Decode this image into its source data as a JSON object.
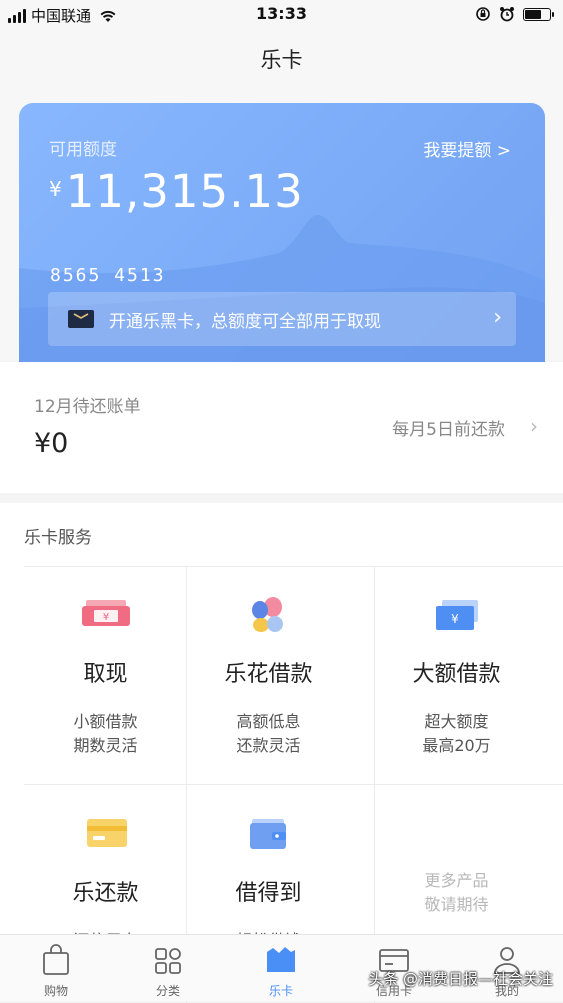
{
  "status_bar": {
    "carrier": "中国联通",
    "time": "13:33",
    "battery_level": 0.7
  },
  "nav": {
    "title": "乐卡"
  },
  "card": {
    "available_label": "可用额度",
    "raise_limit_label": "我要提额 >",
    "currency": "¥",
    "amount": "11,315.13",
    "card_number": "8565  4513",
    "banner_text": "开通乐黑卡，总额度可全部用于取现",
    "colors": {
      "card_top": "#88b7ff",
      "card_bottom": "#6f9ff0"
    }
  },
  "bill": {
    "label": "12月待还账单",
    "amount": "¥0",
    "due_text": "每月5日前还款"
  },
  "services": {
    "title": "乐卡服务",
    "items": [
      {
        "name": "取现",
        "desc1": "小额借款",
        "desc2": "期数灵活",
        "icon": "cash-withdraw-icon"
      },
      {
        "name": "乐花借款",
        "desc1": "高额低息",
        "desc2": "还款灵活",
        "icon": "lehua-petals-icon"
      },
      {
        "name": "大额借款",
        "desc1": "超大额度",
        "desc2": "最高20万",
        "icon": "large-loan-icon"
      },
      {
        "name": "乐还款",
        "desc1": "还信用卡",
        "desc2": "",
        "icon": "repay-card-icon"
      },
      {
        "name": "借得到",
        "desc1": "轻松借钱",
        "desc2": "",
        "icon": "wallet-icon"
      },
      {
        "name": "",
        "desc1": "更多产品",
        "desc2": "敬请期待",
        "icon": ""
      }
    ]
  },
  "tabs": [
    {
      "label": "购物",
      "icon": "shopping-bag-icon",
      "active": false
    },
    {
      "label": "分类",
      "icon": "category-grid-icon",
      "active": false
    },
    {
      "label": "乐卡",
      "icon": "lecard-icon",
      "active": true
    },
    {
      "label": "信用卡",
      "icon": "credit-card-icon",
      "active": false
    },
    {
      "label": "我的",
      "icon": "profile-icon",
      "active": false
    }
  ],
  "watermark": "头条 @消费日报—社会关注"
}
